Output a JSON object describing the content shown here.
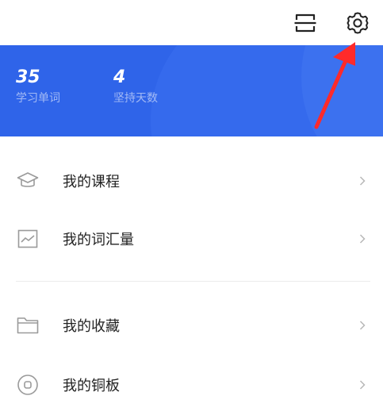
{
  "stats": [
    {
      "value": "35",
      "label": "学习单词"
    },
    {
      "value": "4",
      "label": "坚持天数"
    }
  ],
  "menu": [
    {
      "label": "我的课程",
      "icon": "graduation-cap-icon"
    },
    {
      "label": "我的词汇量",
      "icon": "chart-icon"
    },
    {
      "label": "我的收藏",
      "icon": "folder-icon"
    },
    {
      "label": "我的铜板",
      "icon": "coin-icon"
    }
  ],
  "colors": {
    "banner": "#2f64e9",
    "annotation_arrow": "#ff2a2a"
  }
}
